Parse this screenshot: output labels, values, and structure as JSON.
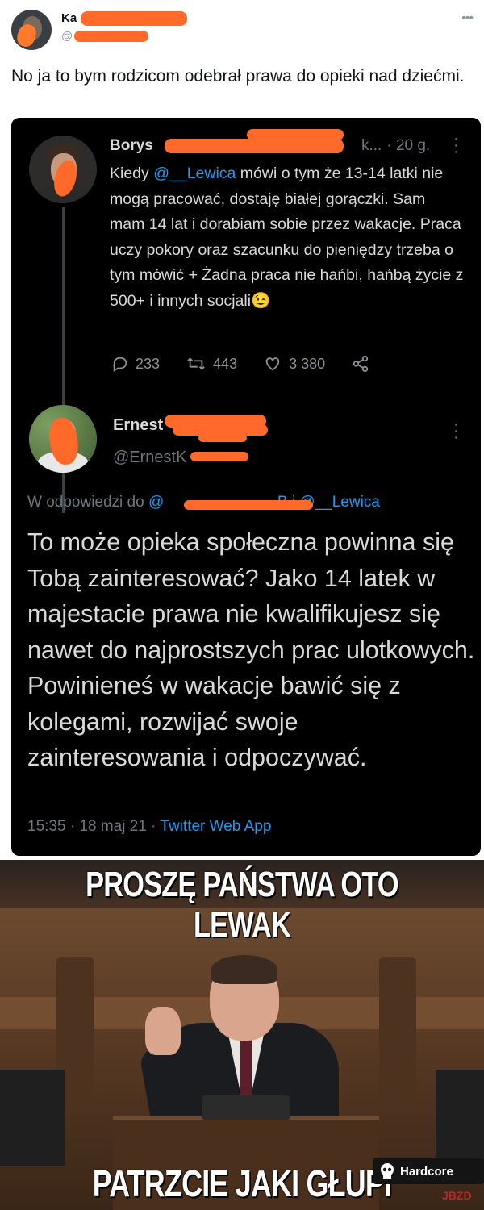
{
  "outer_tweet": {
    "name": "Ka",
    "handle": "@",
    "text": "No ja to bym rodzicom odebrał prawa do opieki nad dziećmi."
  },
  "quoted_tweet_1": {
    "name": "Borys",
    "handle_fragment": "k...",
    "time": "· 20 g.",
    "text_before_mention": "Kiedy ",
    "mention": "@__Lewica",
    "text_after_mention": " mówi o tym że 13-14 latki nie mogą pracować, dostaję białej gorączki. Sam mam 14 lat i dorabiam sobie przez wakacje. Praca uczy pokory oraz szacunku do pieniędzy trzeba o tym mówić + Żadna praca nie hańbi, hańbą życie z 500+ i innych socjali",
    "emoji": "😉",
    "replies": "233",
    "retweets": "443",
    "likes": "3 380"
  },
  "quoted_tweet_2": {
    "name": "Ernest",
    "handle": "@ErnestK",
    "reply_prefix": "W odpowiedzi do ",
    "reply_mention_1_suffix": "_B",
    "reply_and": " i ",
    "reply_mention_2": "@__Lewica",
    "text": "To może opieka społeczna powinna się Tobą zainteresować? Jako 14 latek w majestacie prawa nie kwalifikujesz się nawet do najprostszych prac ulotkowych. Powinieneś w wakacje bawić się z kolegami, rozwijać swoje zainteresowania i odpoczywać.",
    "timestamp": "15:35 · 18 maj 21 · ",
    "app": "Twitter Web App"
  },
  "meme": {
    "top_caption": "PROSZĘ PAŃSTWA OTO LEWAK",
    "bottom_caption": "PATRZCIE JAKI GŁUPI"
  },
  "watermark": {
    "label": "Hardcore",
    "site": "JBZD"
  },
  "colors": {
    "redaction": "#ff6a2a",
    "link_blue": "#1d9bf0",
    "dark_bg": "#000000"
  }
}
